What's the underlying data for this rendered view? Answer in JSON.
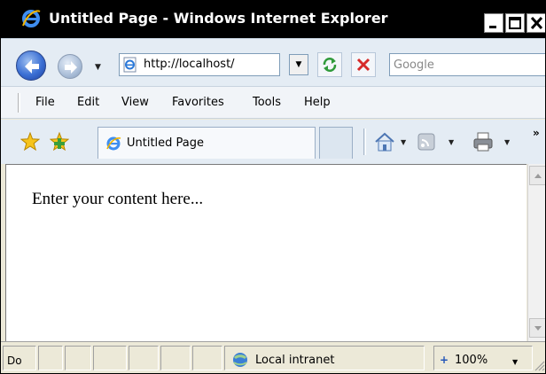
{
  "window": {
    "title": "Untitled Page - Windows Internet Explorer"
  },
  "icons": {
    "browser": "ie-logo-icon",
    "back": "back-arrow-icon",
    "forward": "forward-arrow-icon",
    "page": "page-icon",
    "refresh": "refresh-icon",
    "stop": "stop-icon",
    "favorites": "favorites-star-icon",
    "add_favorite": "add-favorite-icon",
    "home": "home-icon",
    "feeds": "feeds-icon",
    "print": "print-icon",
    "zone": "network-zone-icon",
    "zoom": "zoom-icon"
  },
  "address": {
    "url": "http://localhost/",
    "search_placeholder": "Google"
  },
  "menu": {
    "items": [
      "File",
      "Edit",
      "View",
      "Favorites",
      "Tools",
      "Help"
    ]
  },
  "tab": {
    "label": "Untitled Page"
  },
  "toolbar": {
    "chevron": "»"
  },
  "content": {
    "text": "Enter your content here..."
  },
  "status": {
    "text": "Do",
    "zone": "Local intranet",
    "zoom": "100%"
  },
  "colors": {
    "titlebar": "#000000",
    "toolbar": "#e4ecf4",
    "statusbar": "#ece9d8",
    "accent": "#3b6fd4"
  }
}
